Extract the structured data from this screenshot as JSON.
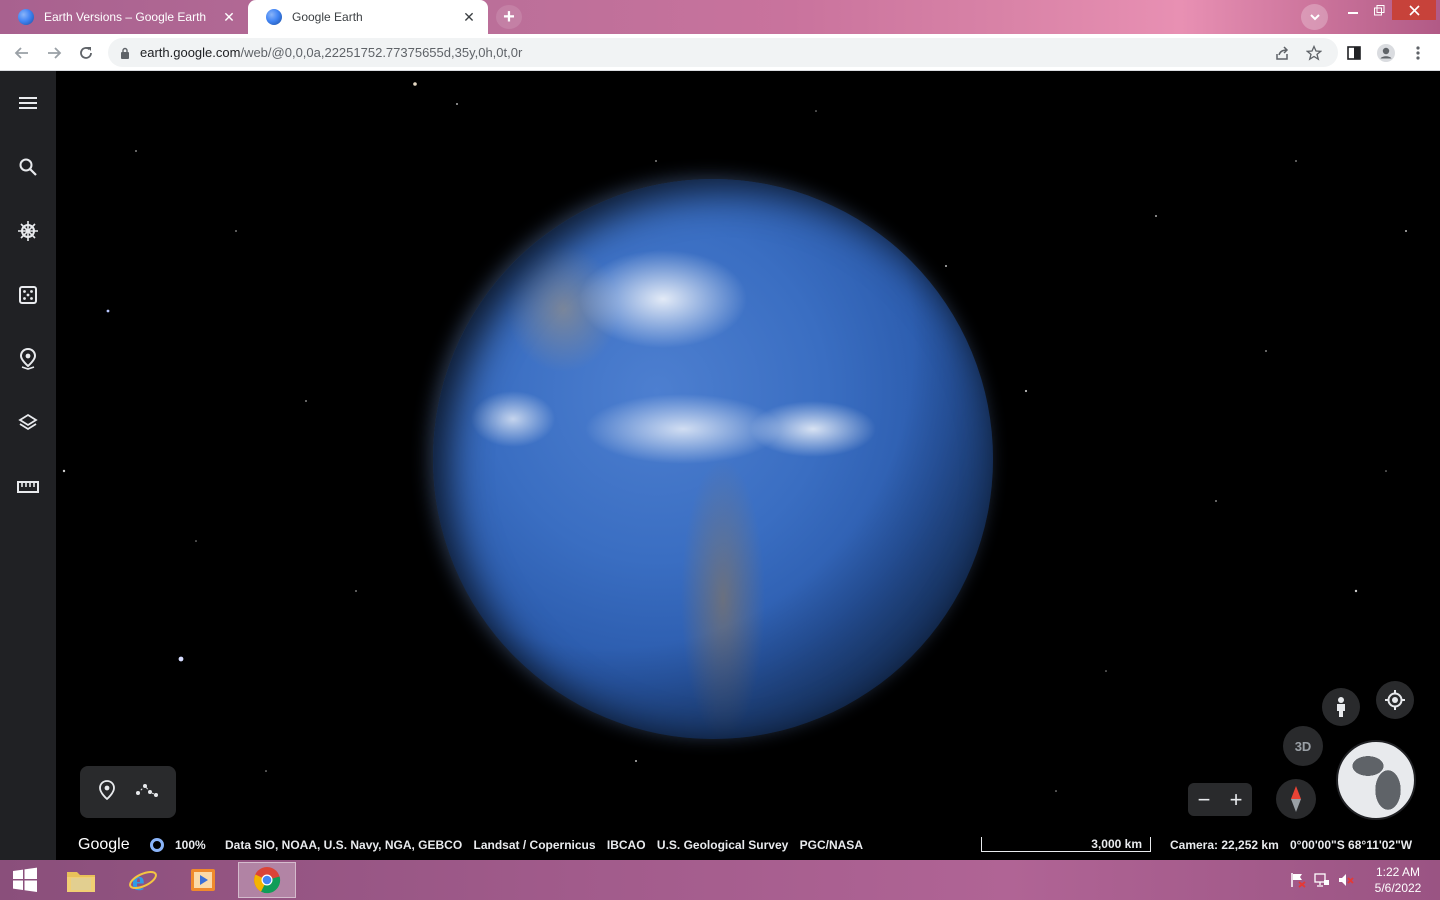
{
  "browser": {
    "tabs": [
      {
        "title": "Earth Versions – Google Earth",
        "active": false
      },
      {
        "title": "Google Earth",
        "active": true
      }
    ],
    "url": {
      "domain": "earth.google.com",
      "path": "/web/@0,0,0a,22251752.77375655d,35y,0h,0t,0r"
    }
  },
  "sidebar": {
    "items": [
      {
        "name": "menu",
        "icon": "menu-icon"
      },
      {
        "name": "search",
        "icon": "search-icon"
      },
      {
        "name": "voyager",
        "icon": "ship-wheel-icon"
      },
      {
        "name": "feeling-lucky",
        "icon": "dice-icon"
      },
      {
        "name": "projects",
        "icon": "place-icon"
      },
      {
        "name": "map-style",
        "icon": "layers-icon"
      },
      {
        "name": "measure",
        "icon": "ruler-icon"
      }
    ]
  },
  "tools": {
    "items": [
      {
        "name": "placemark",
        "icon": "pin-icon"
      },
      {
        "name": "path",
        "icon": "path-icon"
      }
    ]
  },
  "controls": {
    "three_d_label": "3D",
    "zoom_out": "−",
    "zoom_in": "+"
  },
  "status": {
    "logo": "Google",
    "progress": "100%",
    "attribution": [
      "Data SIO, NOAA, U.S. Navy, NGA, GEBCO",
      "Landsat / Copernicus",
      "IBCAO",
      "U.S. Geological Survey",
      "PGC/NASA"
    ],
    "scale": "3,000 km",
    "camera": "Camera: 22,252 km",
    "coordinates": "0°00'00\"S 68°11'02\"W"
  },
  "taskbar": {
    "time": "1:22 AM",
    "date": "5/6/2022"
  },
  "colors": {
    "sidebar_bg": "#202124",
    "accent_blue": "#8ab4f8",
    "compass_red": "#ea4335"
  }
}
